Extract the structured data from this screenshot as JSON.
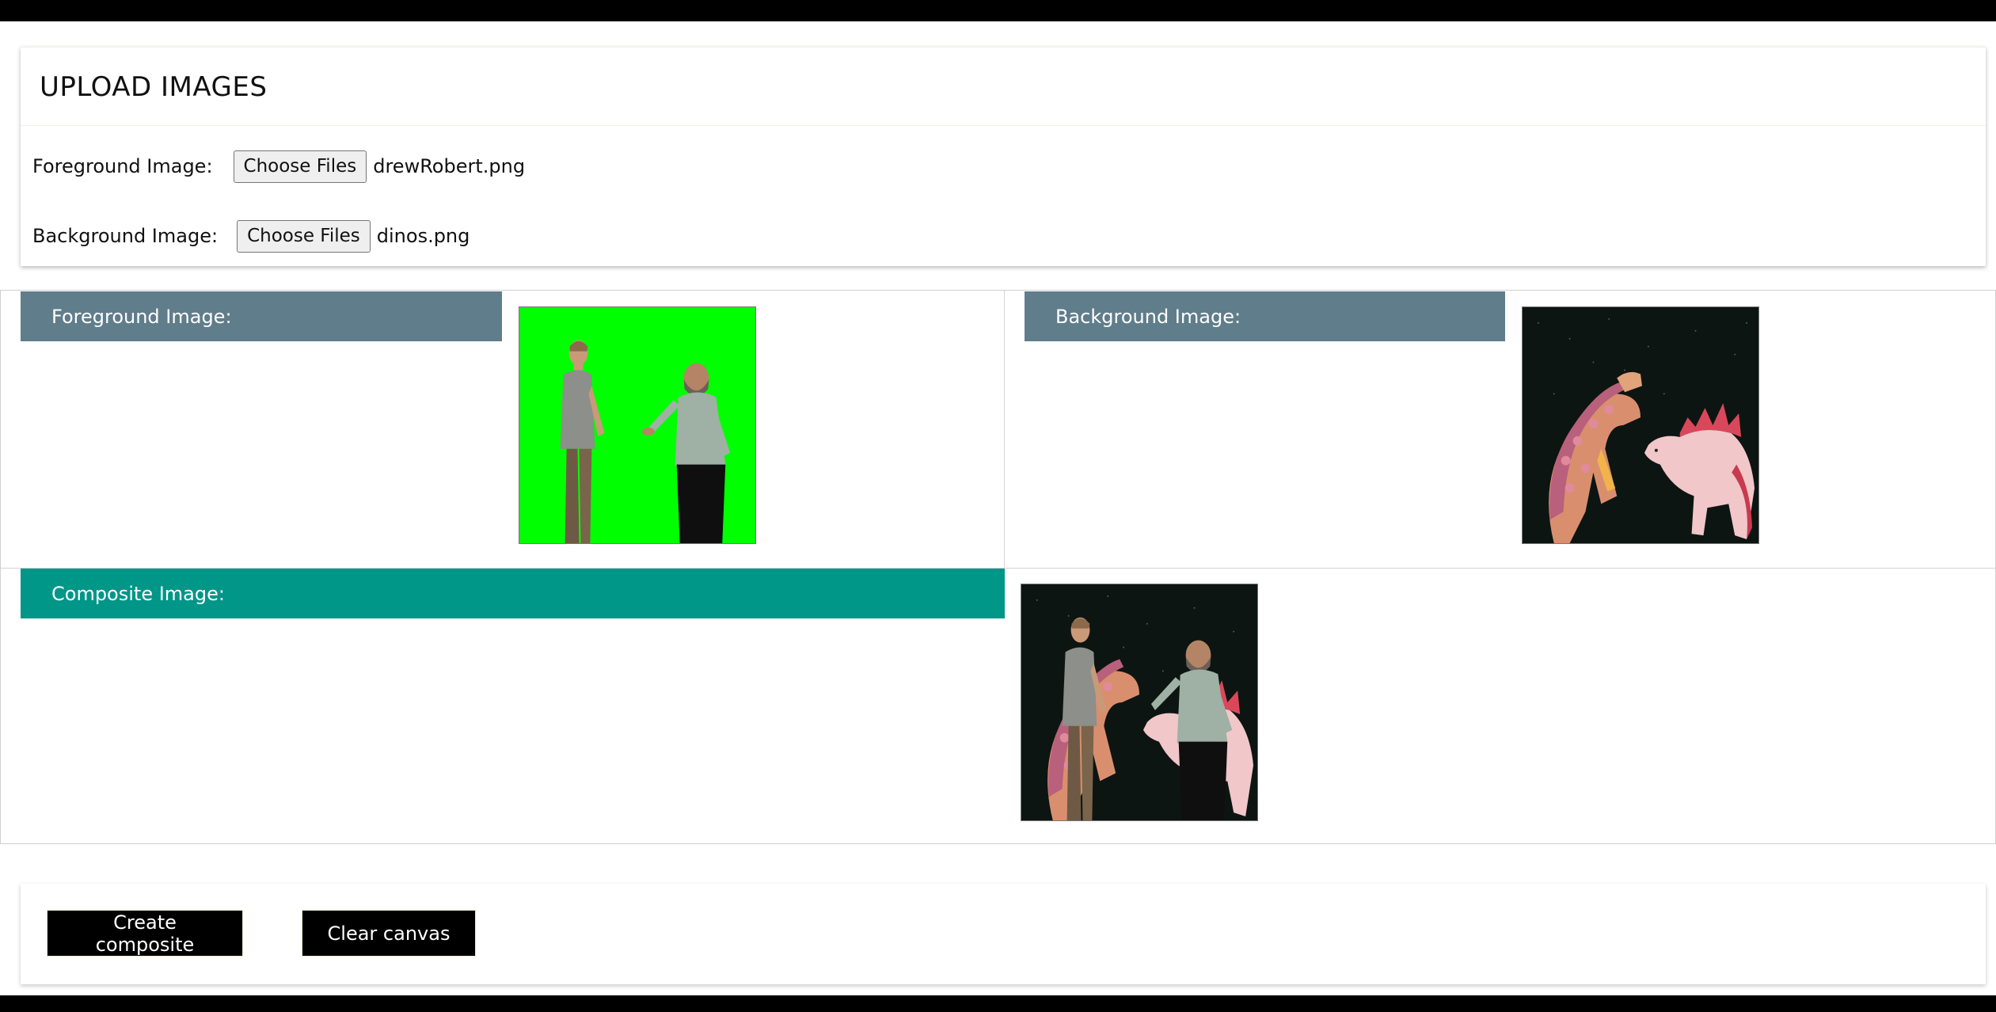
{
  "upload": {
    "title": "UPLOAD IMAGES",
    "foreground": {
      "label": "Foreground Image:",
      "button_label": "Choose Files",
      "file_name": "drewRobert.png"
    },
    "background": {
      "label": "Background Image:",
      "button_label": "Choose Files",
      "file_name": "dinos.png"
    }
  },
  "preview": {
    "foreground_label": "Foreground Image:",
    "background_label": "Background Image:",
    "composite_label": "Composite Image:"
  },
  "actions": {
    "create_label": "Create composite",
    "clear_label": "Clear canvas"
  },
  "colors": {
    "label_bar": "#607d8b",
    "composite_bar": "#009688",
    "green_screen": "#00ff00",
    "action_button": "#000000"
  }
}
